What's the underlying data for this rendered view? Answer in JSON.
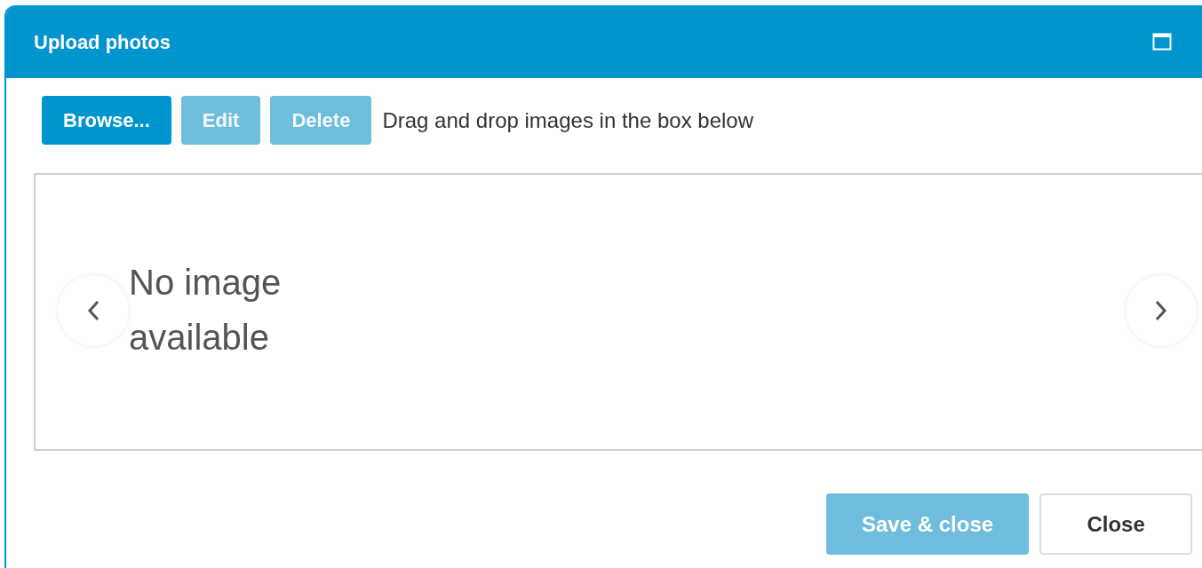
{
  "dialog": {
    "title": "Upload photos"
  },
  "toolbar": {
    "buttons": [
      {
        "label": "Browse...",
        "disabled": false
      },
      {
        "label": "Edit",
        "disabled": true
      },
      {
        "label": "Delete",
        "disabled": true
      }
    ],
    "hint": "Drag and drop images in the box below"
  },
  "gallery": {
    "empty_text": "No image available"
  },
  "footer": {
    "buttons": [
      {
        "label": "Save & close",
        "kind": "primary",
        "disabled": true
      },
      {
        "label": "Close",
        "kind": "secondary",
        "disabled": false
      }
    ]
  }
}
